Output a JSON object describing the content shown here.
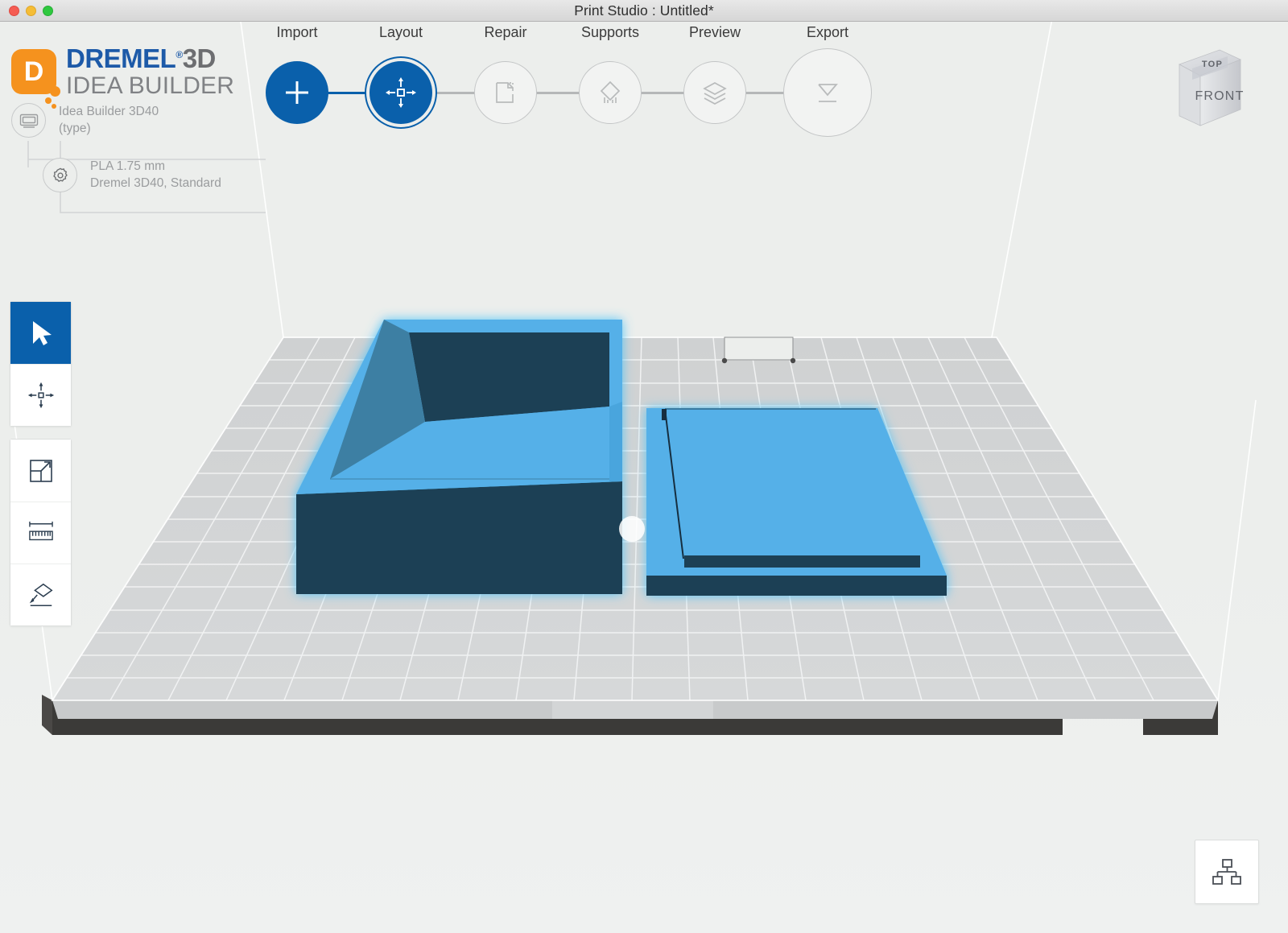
{
  "window": {
    "title": "Print Studio : Untitled*",
    "traffic_lights": [
      "close-red",
      "minimize-yellow",
      "zoom-green"
    ]
  },
  "brand": {
    "mark_letter": "D",
    "line1_primary": "DREMEL",
    "line1_registered": "®",
    "line1_secondary": "3D",
    "line2": "IDEA BUILDER",
    "colors": {
      "orange": "#f5921e",
      "blue": "#1d5aa8",
      "gray": "#6d6e71"
    }
  },
  "sidebar": {
    "nodes": [
      {
        "icon": "printer-icon",
        "line1": "Idea Builder 3D40",
        "line2": "(type)"
      },
      {
        "icon": "gear-icon",
        "line1": "PLA 1.75 mm",
        "line2": "Dremel 3D40, Standard"
      }
    ]
  },
  "workflow": {
    "accent": "#0a60ab",
    "steps": [
      {
        "label": "Import",
        "icon": "plus-icon",
        "state": "complete"
      },
      {
        "label": "Layout",
        "icon": "move-icon",
        "state": "current"
      },
      {
        "label": "Repair",
        "icon": "repair-icon",
        "state": "pending"
      },
      {
        "label": "Supports",
        "icon": "supports-icon",
        "state": "pending"
      },
      {
        "label": "Preview",
        "icon": "layers-icon",
        "state": "pending"
      },
      {
        "label": "Export",
        "icon": "export-icon",
        "state": "pending"
      }
    ]
  },
  "tools": {
    "groups": [
      {
        "name": "transform-tools",
        "items": [
          {
            "icon": "select-arrow-icon",
            "active": true
          },
          {
            "icon": "move-arrows-icon",
            "active": false
          }
        ]
      },
      {
        "name": "measure-tools",
        "items": [
          {
            "icon": "scale-icon",
            "active": false
          },
          {
            "icon": "ruler-icon",
            "active": false
          },
          {
            "icon": "place-face-icon",
            "active": false
          }
        ]
      }
    ]
  },
  "viewcube": {
    "top_label": "TOP",
    "front_label": "FRONT"
  },
  "model_tree_button": {
    "icon": "hierarchy-icon"
  },
  "scene": {
    "build_plate": {
      "top_color": "#d3d5d6",
      "edge_color": "#3b3a38",
      "grid_color": "#f2f3f4"
    },
    "objects": [
      {
        "name": "open-box-tray",
        "selected": true,
        "light_color": "#55b0e8",
        "dark_color": "#1f4055",
        "mid_color": "#3c7fa3",
        "glow_color": "#4ec3f7"
      },
      {
        "name": "flat-lid-plate",
        "selected": true,
        "light_color": "#55b0e8",
        "dark_color": "#1f4055",
        "glow_color": "#4ec3f7"
      }
    ]
  }
}
